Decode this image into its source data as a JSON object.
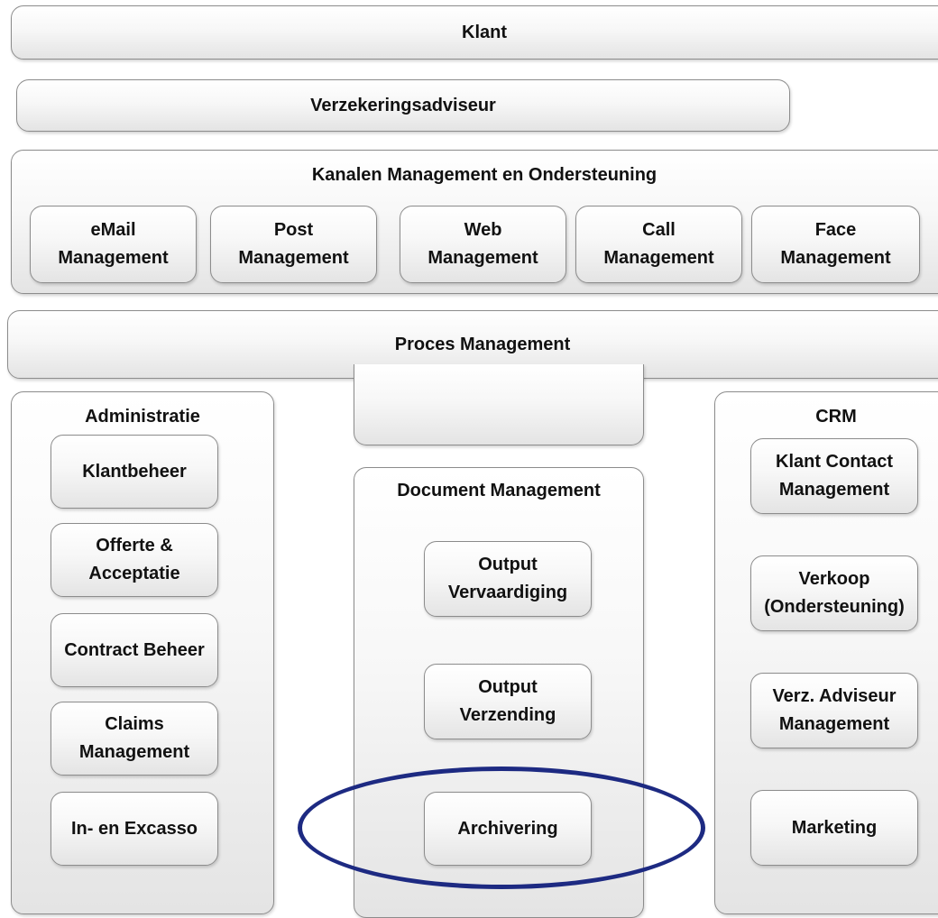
{
  "layers": {
    "klant": "Klant",
    "verzekeringsadviseur": "Verzekeringsadviseur",
    "kanalen": {
      "title": "Kanalen Management en Ondersteuning",
      "items": [
        "eMail\nManagement",
        "Post\nManagement",
        "Web\nManagement",
        "Call\nManagement",
        "Face\nManagement"
      ]
    },
    "proces": "Proces Management"
  },
  "administratie": {
    "title": "Administratie",
    "items": [
      "Klantbeheer",
      "Offerte &\nAcceptatie",
      "Contract Beheer",
      "Claims\nManagement",
      "In- en Excasso"
    ]
  },
  "document_management": {
    "title": "Document Management",
    "items": [
      "Output\nVervaardiging",
      "Output\nVerzending",
      "Archivering"
    ]
  },
  "crm": {
    "title": "CRM",
    "items": [
      "Klant Contact\nManagement",
      "Verkoop\n(Ondersteuning)",
      "Verz. Adviseur\nManagement",
      "Marketing"
    ]
  },
  "highlight": {
    "color": "#1d2a82",
    "target": "Archivering"
  }
}
